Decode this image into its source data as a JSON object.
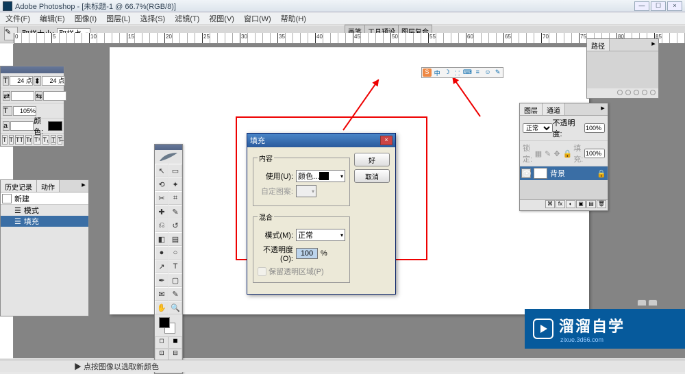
{
  "titlebar": {
    "app": "Adobe Photoshop",
    "doc": "[未标题-1 @ 66.7%(RGB/8)]"
  },
  "menu": [
    "文件(F)",
    "编辑(E)",
    "图像(I)",
    "图层(L)",
    "选择(S)",
    "滤镜(T)",
    "视图(V)",
    "窗口(W)",
    "帮助(H)"
  ],
  "options": {
    "label_sample": "取样大小:",
    "sample_value": "取样点",
    "tabs": [
      "画笔",
      "工具预设",
      "图层复合"
    ]
  },
  "prop": {
    "val1": "24 点",
    "val2": "24 点",
    "pct": "105%",
    "color_label": "颜色:"
  },
  "history": {
    "tabs": [
      "历史记录",
      "动作"
    ],
    "head": "新建",
    "items": [
      "模式",
      "填充"
    ]
  },
  "dialog": {
    "title": "填充",
    "grp_content": "内容",
    "use_label": "使用(U):",
    "use_value": "颜色...",
    "pattern_label": "自定图案:",
    "grp_blend": "混合",
    "mode_label": "模式(M):",
    "mode_value": "正常",
    "opacity_label": "不透明度(O):",
    "opacity_value": "100",
    "pct": "%",
    "preserve": "保留透明区域(P)",
    "ok": "好",
    "cancel": "取消"
  },
  "layers": {
    "tabs": [
      "图层",
      "通道"
    ],
    "mode": "正常",
    "opacity_label": "不透明度:",
    "opacity": "100%",
    "lock_label": "锁定:",
    "fill_label": "填充:",
    "fill": "100%",
    "layer_name": "背景"
  },
  "paths": {
    "tab": "路径"
  },
  "status": {
    "zoom": "",
    "hint": "▶ 点按图像以选取新颜色"
  },
  "watermark": {
    "brand": "溜溜自学",
    "sub": "zixue.3d66.com"
  },
  "ime": {
    "s": "S",
    "zh": "中"
  }
}
